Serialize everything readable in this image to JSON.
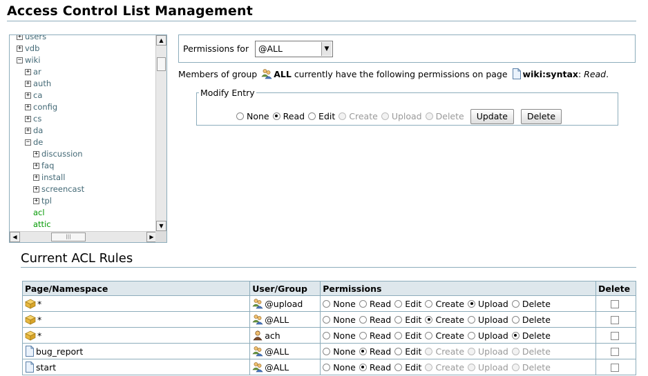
{
  "page_title": "Access Control List Management",
  "tree": {
    "nodes": [
      {
        "label": "users",
        "toggle": "+",
        "indent": 1,
        "type": "ns"
      },
      {
        "label": "vdb",
        "toggle": "+",
        "indent": 1,
        "type": "ns"
      },
      {
        "label": "wiki",
        "toggle": "−",
        "indent": 1,
        "type": "ns"
      },
      {
        "label": "ar",
        "toggle": "+",
        "indent": 2,
        "type": "ns"
      },
      {
        "label": "auth",
        "toggle": "+",
        "indent": 2,
        "type": "ns"
      },
      {
        "label": "ca",
        "toggle": "+",
        "indent": 2,
        "type": "ns"
      },
      {
        "label": "config",
        "toggle": "+",
        "indent": 2,
        "type": "ns"
      },
      {
        "label": "cs",
        "toggle": "+",
        "indent": 2,
        "type": "ns"
      },
      {
        "label": "da",
        "toggle": "+",
        "indent": 2,
        "type": "ns"
      },
      {
        "label": "de",
        "toggle": "−",
        "indent": 2,
        "type": "ns"
      },
      {
        "label": "discussion",
        "toggle": "+",
        "indent": 3,
        "type": "ns"
      },
      {
        "label": "faq",
        "toggle": "+",
        "indent": 3,
        "type": "ns"
      },
      {
        "label": "install",
        "toggle": "+",
        "indent": 3,
        "type": "ns"
      },
      {
        "label": "screencast",
        "toggle": "+",
        "indent": 3,
        "type": "ns"
      },
      {
        "label": "tpl",
        "toggle": "+",
        "indent": 3,
        "type": "ns"
      },
      {
        "label": "acl",
        "toggle": "",
        "indent": 3,
        "type": "page"
      },
      {
        "label": "attic",
        "toggle": "",
        "indent": 3,
        "type": "page"
      }
    ]
  },
  "permissions_for": {
    "label": "Permissions for",
    "selected": "@ALL"
  },
  "description": {
    "prefix": "Members of group",
    "group": "ALL",
    "middle": "currently have the following permissions on page",
    "page": "wiki:syntax",
    "suffix_sep": ":",
    "permission": "Read",
    "end": "."
  },
  "modify": {
    "legend": "Modify Entry",
    "options": [
      {
        "label": "None",
        "checked": false,
        "disabled": false
      },
      {
        "label": "Read",
        "checked": true,
        "disabled": false
      },
      {
        "label": "Edit",
        "checked": false,
        "disabled": false
      },
      {
        "label": "Create",
        "checked": false,
        "disabled": true
      },
      {
        "label": "Upload",
        "checked": false,
        "disabled": true
      },
      {
        "label": "Delete",
        "checked": false,
        "disabled": true
      }
    ],
    "update_label": "Update",
    "delete_label": "Delete"
  },
  "rules": {
    "heading": "Current ACL Rules",
    "headers": [
      "Page/Namespace",
      "User/Group",
      "Permissions",
      "Delete"
    ],
    "perm_labels": [
      "None",
      "Read",
      "Edit",
      "Create",
      "Upload",
      "Delete"
    ],
    "rows": [
      {
        "page": "*",
        "page_type": "namespace",
        "user": "@upload",
        "user_type": "group",
        "perm": 4,
        "disabled_from": 6
      },
      {
        "page": "*",
        "page_type": "namespace",
        "user": "@ALL",
        "user_type": "group",
        "perm": 3,
        "disabled_from": 6
      },
      {
        "page": "*",
        "page_type": "namespace",
        "user": "ach",
        "user_type": "user",
        "perm": 5,
        "disabled_from": 6
      },
      {
        "page": "bug_report",
        "page_type": "page",
        "user": "@ALL",
        "user_type": "group",
        "perm": 1,
        "disabled_from": 3
      },
      {
        "page": "start",
        "page_type": "page",
        "user": "@ALL",
        "user_type": "group",
        "perm": 1,
        "disabled_from": 3
      }
    ]
  },
  "colors": {
    "border": "#8cacbb",
    "header_bg": "#dee7ec",
    "namespace_link": "#436976",
    "page_link": "#009900"
  }
}
